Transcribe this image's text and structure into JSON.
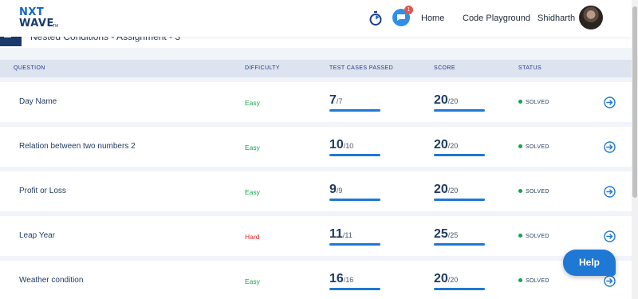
{
  "header": {
    "logo_line1": "NXT",
    "logo_line2": "WAVE",
    "logo_tm": "TM",
    "notification_count": "1",
    "nav_home": "Home",
    "nav_code": "Code Playground",
    "user_name": "Shidharth"
  },
  "breadcrumb": "Nested Conditions - Assignment - 3",
  "table": {
    "headers": [
      "QUESTION",
      "DIFFICULTY",
      "TEST CASES PASSED",
      "SCORE",
      "STATUS"
    ],
    "rows": [
      {
        "question": "Day Name",
        "difficulty": "Easy",
        "passed": "7",
        "total_cases": "/7",
        "score": "20",
        "max_score": "/20",
        "status": "SOLVED"
      },
      {
        "question": "Relation between two numbers 2",
        "difficulty": "Easy",
        "passed": "10",
        "total_cases": "/10",
        "score": "20",
        "max_score": "/20",
        "status": "SOLVED"
      },
      {
        "question": "Profit or Loss",
        "difficulty": "Easy",
        "passed": "9",
        "total_cases": "/9",
        "score": "20",
        "max_score": "/20",
        "status": "SOLVED"
      },
      {
        "question": "Leap Year",
        "difficulty": "Hard",
        "passed": "11",
        "total_cases": "/11",
        "score": "25",
        "max_score": "/25",
        "status": "SOLVED"
      },
      {
        "question": "Weather condition",
        "difficulty": "Easy",
        "passed": "16",
        "total_cases": "/16",
        "score": "20",
        "max_score": "/20",
        "status": "SOLVED"
      }
    ]
  },
  "help_label": "Help",
  "colors": {
    "primary": "#1e78d4",
    "easy": "#16a34a",
    "hard": "#dc2626",
    "header_band": "#dde3ef"
  }
}
